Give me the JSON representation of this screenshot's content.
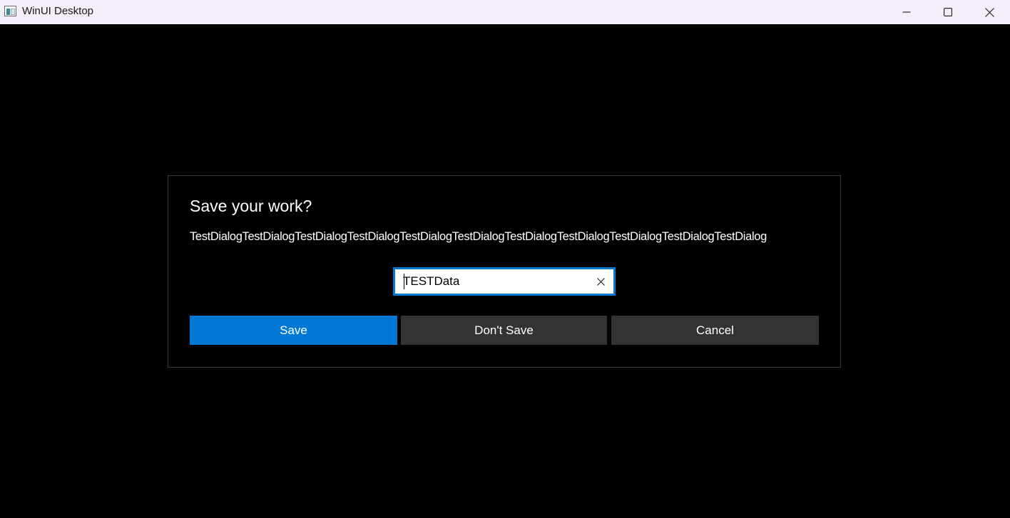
{
  "window": {
    "title": "WinUI Desktop",
    "icon": "app-window-icon",
    "caption_buttons": [
      "minimize-icon",
      "maximize-icon",
      "close-icon"
    ]
  },
  "dialog": {
    "title": "Save your work?",
    "content": "TestDialogTestDialogTestDialogTestDialogTestDialogTestDialogTestDialogTestDialogTestDialogTestDialogTestDialog",
    "input": {
      "value": "TESTData",
      "clear_icon": "clear-icon"
    },
    "buttons": {
      "primary": "Save",
      "secondary": "Don't Save",
      "close": "Cancel"
    }
  },
  "colors": {
    "accent": "#0078d4",
    "secondary_button": "#333333",
    "background": "#000000",
    "titlebar": "#f3eef8"
  }
}
